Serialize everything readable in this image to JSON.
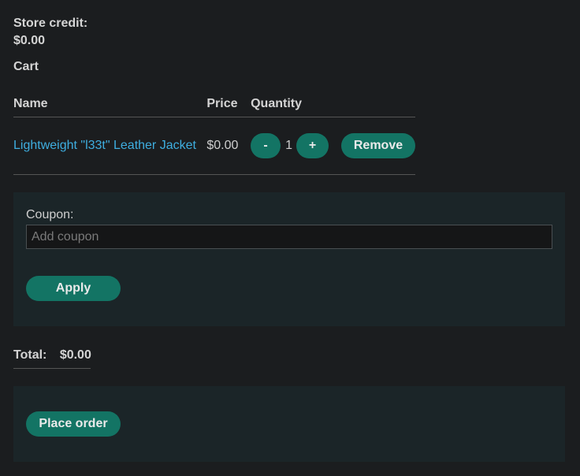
{
  "store_credit": {
    "label": "Store credit:",
    "value": "$0.00"
  },
  "cart": {
    "heading": "Cart",
    "columns": {
      "name": "Name",
      "price": "Price",
      "quantity": "Quantity"
    },
    "items": [
      {
        "name": "Lightweight \"l33t\" Leather Jacket",
        "price": "$0.00",
        "quantity": "1",
        "decrement_label": "-",
        "increment_label": "+",
        "remove_label": "Remove"
      }
    ]
  },
  "coupon": {
    "label": "Coupon:",
    "value": "",
    "placeholder": "Add coupon",
    "apply_label": "Apply"
  },
  "total": {
    "label": "Total:",
    "value": "$0.00"
  },
  "order": {
    "place_label": "Place order"
  },
  "colors": {
    "background": "#1b1d1f",
    "panel": "#1b2528",
    "button": "#137464",
    "link": "#3eaee0"
  }
}
